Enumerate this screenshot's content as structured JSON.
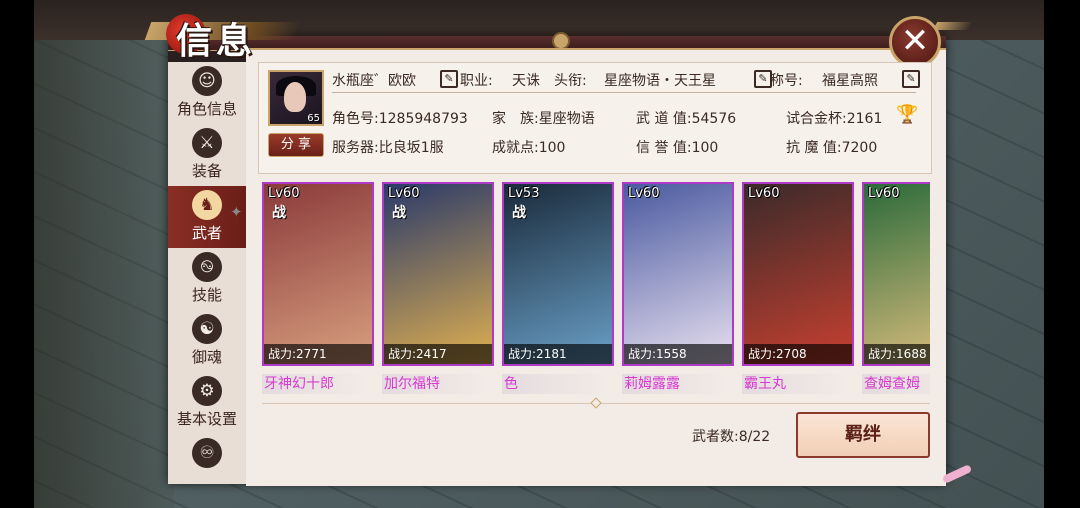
{
  "title": "信息",
  "close_icon": "close-x-icon",
  "sidebar": {
    "items": [
      {
        "label": "角色信息",
        "icon": "character-icon",
        "glyph": "☺"
      },
      {
        "label": "装备",
        "icon": "crossed-swords-icon",
        "glyph": "⚔"
      },
      {
        "label": "武者",
        "icon": "warrior-helmet-icon",
        "glyph": "♞"
      },
      {
        "label": "技能",
        "icon": "swirl-skill-icon",
        "glyph": "࿊"
      },
      {
        "label": "御魂",
        "icon": "spirit-mask-icon",
        "glyph": "☯"
      },
      {
        "label": "基本设置",
        "icon": "gear-icon",
        "glyph": "⚙"
      },
      {
        "label": "",
        "icon": "settings-icon",
        "glyph": "♾"
      }
    ]
  },
  "profile": {
    "name": "水瓶座゛欧欧",
    "avatar_level": "65",
    "job_label": "职业:",
    "job": "天诛",
    "rank_label": "头衔:",
    "rank": "星座物语・天王星",
    "title_label": "称号:",
    "title_value": "福星高照",
    "share_label": "分 享",
    "role_id": "角色号:1285948793",
    "family": "家　族:星座物语",
    "martial": "武 道 值:54576",
    "cup": "试合金杯:2161",
    "server": "服务器:比良坂1服",
    "achievement": "成就点:100",
    "reputation": "信 誉 值:100",
    "resist": "抗 魔 值:7200"
  },
  "heroes": [
    {
      "level": "Lv60",
      "stamp": "战",
      "power": "战力:2771",
      "name": "牙神幻十郎",
      "art_top": "#8a3a3a",
      "art_bottom": "#d9a080"
    },
    {
      "level": "Lv60",
      "stamp": "战",
      "power": "战力:2417",
      "name": "加尔福特",
      "art_top": "#2a3a6a",
      "art_bottom": "#e0b050"
    },
    {
      "level": "Lv53",
      "stamp": "战",
      "power": "战力:2181",
      "name": "色",
      "art_top": "#1a2a3a",
      "art_bottom": "#6aa0c8"
    },
    {
      "level": "Lv60",
      "stamp": "",
      "power": "战力:1558",
      "name": "莉姆露露",
      "art_top": "#4a5aa0",
      "art_bottom": "#e8e0f0"
    },
    {
      "level": "Lv60",
      "stamp": "",
      "power": "战力:2708",
      "name": "霸王丸",
      "art_top": "#3a2a2a",
      "art_bottom": "#c84030"
    },
    {
      "level": "Lv60",
      "stamp": "",
      "power": "战力:1688",
      "name": "查姆查姆",
      "art_top": "#2a6a3a",
      "art_bottom": "#e0c080"
    }
  ],
  "hero_count": "武者数:8/22",
  "bond_label": "羁绊"
}
